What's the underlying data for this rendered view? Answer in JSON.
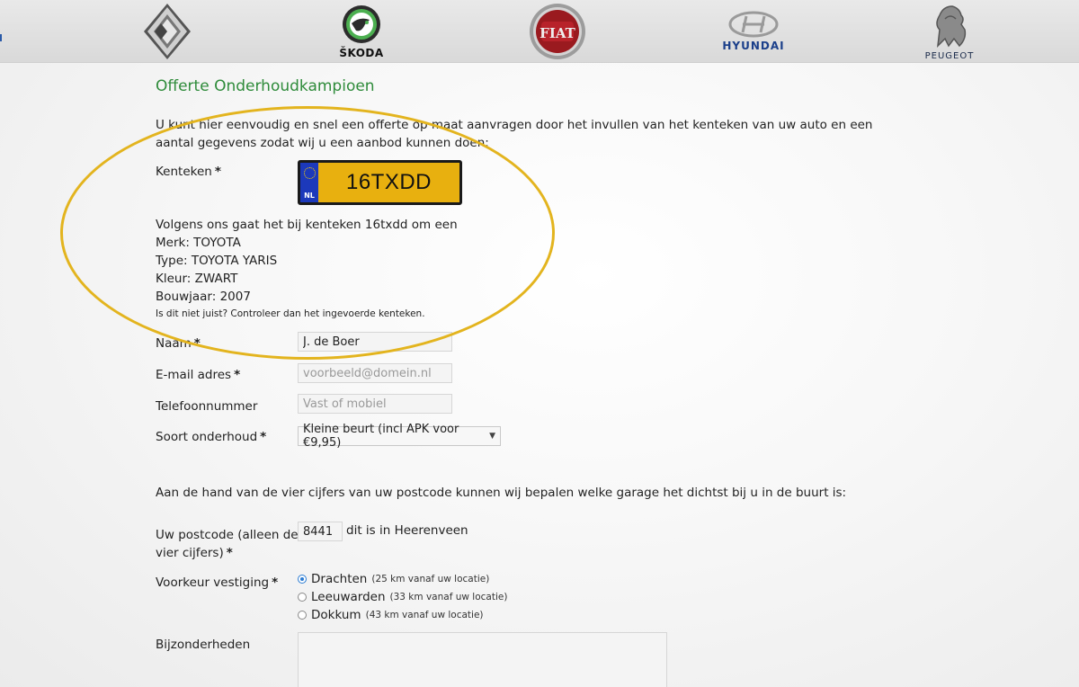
{
  "brands": [
    {
      "id": "renault",
      "name": ""
    },
    {
      "id": "skoda",
      "name": "ŠKODA"
    },
    {
      "id": "fiat",
      "name": "FIAT"
    },
    {
      "id": "hyundai",
      "name": "HYUNDAI"
    },
    {
      "id": "peugeot",
      "name": "PEUGEOT"
    }
  ],
  "page": {
    "title": "Offerte Onderhoudkampioen",
    "intro": "U kunt hier eenvoudig en snel een offerte op maat aanvragen door het invullen van het kenteken van uw auto en een aantal gegevens zodat wij u een aanbod kunnen doen:"
  },
  "form": {
    "kenteken_label": "Kenteken",
    "required_mark": "*",
    "plate": {
      "country": "NL",
      "value": "16TXDD"
    },
    "vehicle": {
      "intro": "Volgens ons gaat het bij kenteken 16txdd om een",
      "merk": "Merk: TOYOTA",
      "type": "Type: TOYOTA YARIS",
      "kleur": "Kleur: ZWART",
      "bouwjaar": "Bouwjaar: 2007",
      "note": "Is dit niet juist? Controleer dan het ingevoerde kenteken."
    },
    "naam_label": "Naam",
    "naam_value": "J. de Boer",
    "email_label": "E-mail adres",
    "email_placeholder": "voorbeeld@domein.nl",
    "telefoon_label": "Telefoonnummer",
    "telefoon_placeholder": "Vast of mobiel",
    "onderhoud_label": "Soort onderhoud",
    "onderhoud_value": "Kleine beurt (incl APK voor €9,95)",
    "postcode_intro": "Aan de hand van de vier cijfers van uw postcode kunnen wij bepalen welke garage het dichtst bij u in de buurt is:",
    "postcode_label_1": "Uw postcode (alleen de",
    "postcode_label_2": "vier cijfers)",
    "postcode_value": "8441",
    "postcode_result": "dit is in Heerenveen",
    "vestiging_label": "Voorkeur vestiging",
    "vestigingen": [
      {
        "name": "Drachten",
        "distance": "(25 km vanaf uw locatie)",
        "checked": true
      },
      {
        "name": "Leeuwarden",
        "distance": "(33 km vanaf uw locatie)",
        "checked": false
      },
      {
        "name": "Dokkum",
        "distance": "(43 km vanaf uw locatie)",
        "checked": false
      }
    ],
    "bijzonderheden_label": "Bijzonderheden"
  },
  "colors": {
    "title_green": "#2e8b3a",
    "highlight": "#e3b41e",
    "plate_yellow": "#e8b00f",
    "plate_blue": "#1c39bb"
  }
}
